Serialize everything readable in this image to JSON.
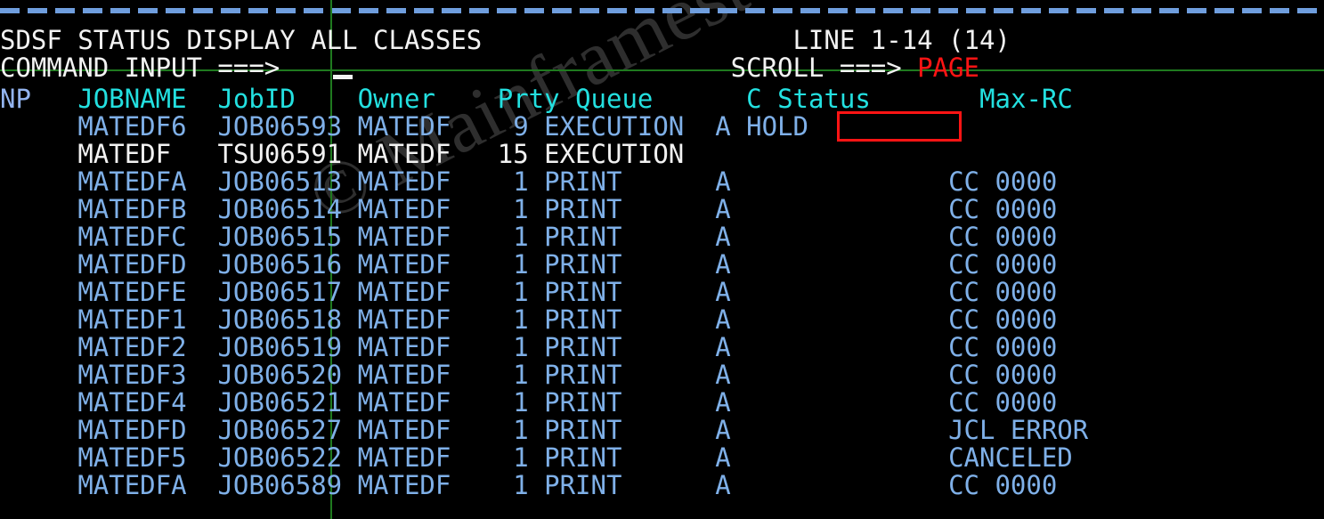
{
  "terminal": {
    "title": "SDSF STATUS DISPLAY ALL CLASSES",
    "line_indicator": "LINE 1-14 (14)",
    "command_label": "COMMAND INPUT ===>",
    "command_value": "",
    "scroll_label": "SCROLL ===>",
    "scroll_value": "PAGE",
    "dash_rule": "------------------------------------------------",
    "cursor": "_",
    "watermark": "© Mainframestechhelp"
  },
  "colors": {
    "background": "#000000",
    "white": "#f2f2f2",
    "cyan": "#23e0e0",
    "blue": "#7fb0e8",
    "red": "#ff1414",
    "green_rule": "#1f7a1f",
    "dash_blue": "#6f9ede",
    "watermark": "#2e2e2e"
  },
  "table": {
    "columns": [
      {
        "key": "np",
        "label": "NP"
      },
      {
        "key": "jobname",
        "label": "JOBNAME"
      },
      {
        "key": "jobid",
        "label": "JobID"
      },
      {
        "key": "owner",
        "label": "Owner"
      },
      {
        "key": "prty",
        "label": "Prty"
      },
      {
        "key": "queue",
        "label": "Queue"
      },
      {
        "key": "c",
        "label": "C"
      },
      {
        "key": "status",
        "label": "Status"
      },
      {
        "key": "maxrc",
        "label": "Max-RC"
      }
    ],
    "header_line": "NP   JOBNAME  JobID    Owner    Prty Queue      C Status       Max-RC",
    "rows": [
      {
        "np": "",
        "jobname": "MATEDF6",
        "jobid": "JOB06593",
        "owner": "MATEDF",
        "prty": "9",
        "queue": "EXECUTION",
        "c": "A",
        "status": "HOLD",
        "maxrc": "",
        "tone": "blue",
        "highlight": "status"
      },
      {
        "np": "",
        "jobname": "MATEDF",
        "jobid": "TSU06591",
        "owner": "MATEDF",
        "prty": "15",
        "queue": "EXECUTION",
        "c": "",
        "status": "",
        "maxrc": "",
        "tone": "white",
        "highlight": ""
      },
      {
        "np": "",
        "jobname": "MATEDFA",
        "jobid": "JOB06513",
        "owner": "MATEDF",
        "prty": "1",
        "queue": "PRINT",
        "c": "A",
        "status": "",
        "maxrc": "CC 0000",
        "tone": "blue",
        "highlight": ""
      },
      {
        "np": "",
        "jobname": "MATEDFB",
        "jobid": "JOB06514",
        "owner": "MATEDF",
        "prty": "1",
        "queue": "PRINT",
        "c": "A",
        "status": "",
        "maxrc": "CC 0000",
        "tone": "blue",
        "highlight": ""
      },
      {
        "np": "",
        "jobname": "MATEDFC",
        "jobid": "JOB06515",
        "owner": "MATEDF",
        "prty": "1",
        "queue": "PRINT",
        "c": "A",
        "status": "",
        "maxrc": "CC 0000",
        "tone": "blue",
        "highlight": ""
      },
      {
        "np": "",
        "jobname": "MATEDFD",
        "jobid": "JOB06516",
        "owner": "MATEDF",
        "prty": "1",
        "queue": "PRINT",
        "c": "A",
        "status": "",
        "maxrc": "CC 0000",
        "tone": "blue",
        "highlight": ""
      },
      {
        "np": "",
        "jobname": "MATEDFE",
        "jobid": "JOB06517",
        "owner": "MATEDF",
        "prty": "1",
        "queue": "PRINT",
        "c": "A",
        "status": "",
        "maxrc": "CC 0000",
        "tone": "blue",
        "highlight": ""
      },
      {
        "np": "",
        "jobname": "MATEDF1",
        "jobid": "JOB06518",
        "owner": "MATEDF",
        "prty": "1",
        "queue": "PRINT",
        "c": "A",
        "status": "",
        "maxrc": "CC 0000",
        "tone": "blue",
        "highlight": ""
      },
      {
        "np": "",
        "jobname": "MATEDF2",
        "jobid": "JOB06519",
        "owner": "MATEDF",
        "prty": "1",
        "queue": "PRINT",
        "c": "A",
        "status": "",
        "maxrc": "CC 0000",
        "tone": "blue",
        "highlight": ""
      },
      {
        "np": "",
        "jobname": "MATEDF3",
        "jobid": "JOB06520",
        "owner": "MATEDF",
        "prty": "1",
        "queue": "PRINT",
        "c": "A",
        "status": "",
        "maxrc": "CC 0000",
        "tone": "blue",
        "highlight": ""
      },
      {
        "np": "",
        "jobname": "MATEDF4",
        "jobid": "JOB06521",
        "owner": "MATEDF",
        "prty": "1",
        "queue": "PRINT",
        "c": "A",
        "status": "",
        "maxrc": "CC 0000",
        "tone": "blue",
        "highlight": ""
      },
      {
        "np": "",
        "jobname": "MATEDFD",
        "jobid": "JOB06527",
        "owner": "MATEDF",
        "prty": "1",
        "queue": "PRINT",
        "c": "A",
        "status": "",
        "maxrc": "JCL ERROR",
        "tone": "blue",
        "highlight": ""
      },
      {
        "np": "",
        "jobname": "MATEDF5",
        "jobid": "JOB06522",
        "owner": "MATEDF",
        "prty": "1",
        "queue": "PRINT",
        "c": "A",
        "status": "",
        "maxrc": "CANCELED",
        "tone": "blue",
        "highlight": ""
      },
      {
        "np": "",
        "jobname": "MATEDFA",
        "jobid": "JOB06589",
        "owner": "MATEDF",
        "prty": "1",
        "queue": "PRINT",
        "c": "A",
        "status": "",
        "maxrc": "CC 0000",
        "tone": "blue",
        "highlight": ""
      }
    ]
  }
}
